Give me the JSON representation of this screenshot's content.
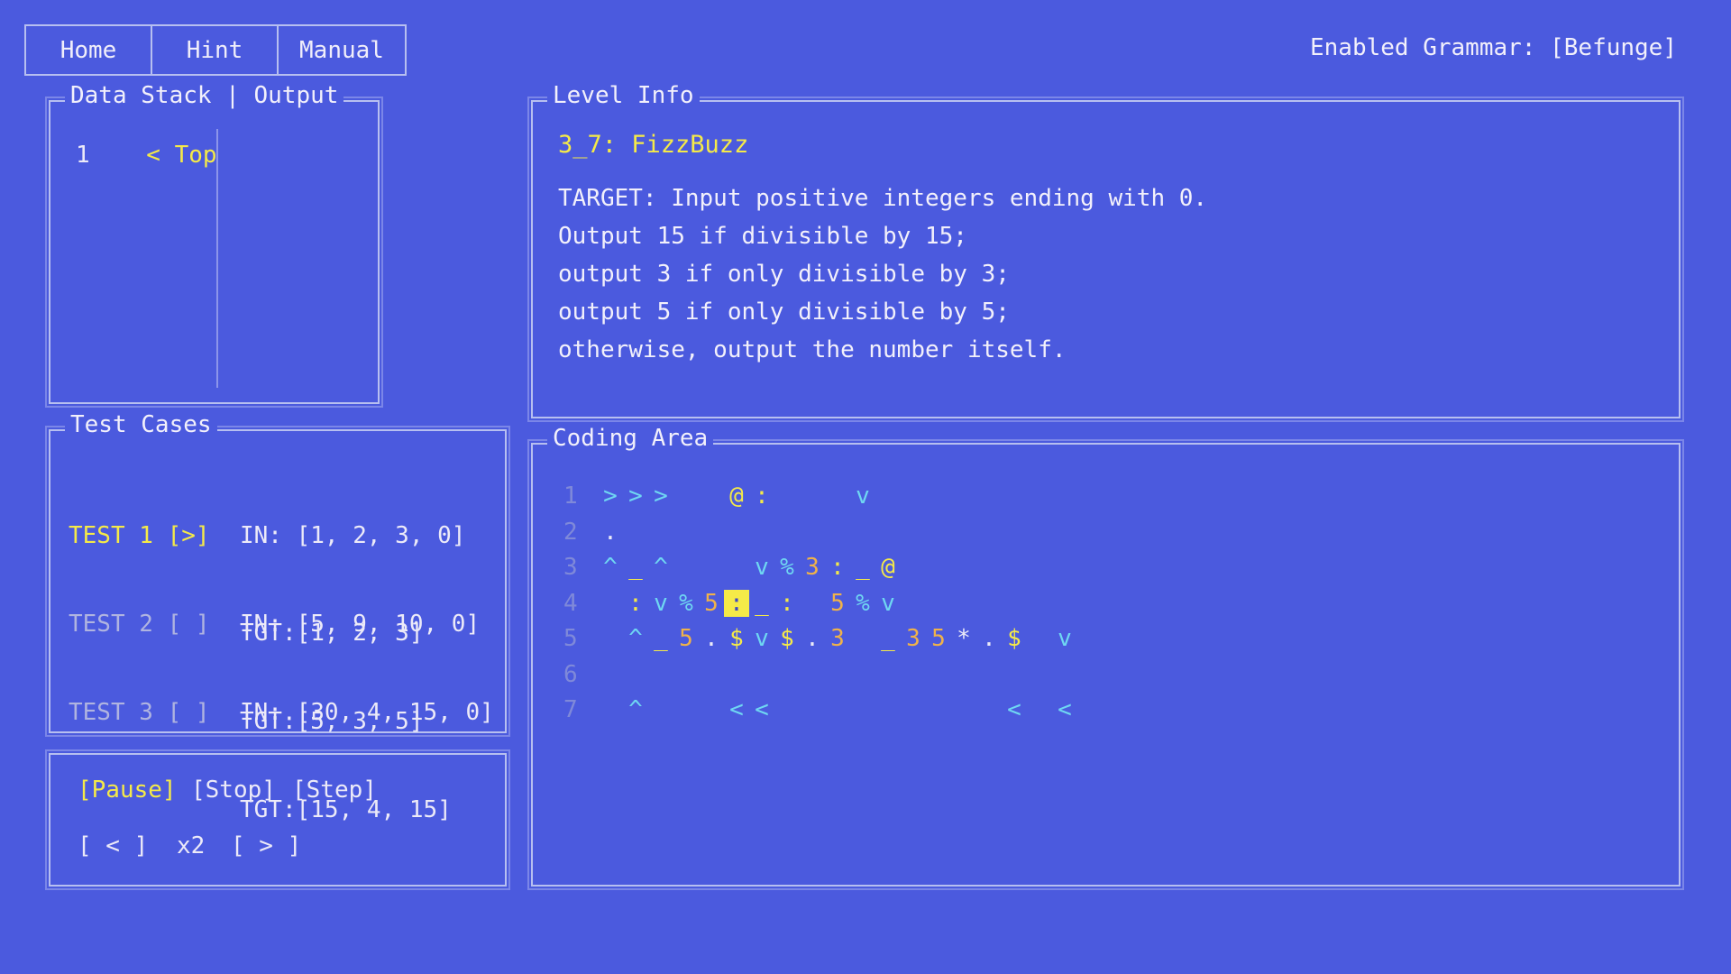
{
  "nav": {
    "home": "Home",
    "hint": "Hint",
    "manual": "Manual"
  },
  "grammar": "Enabled Grammar: [Befunge]",
  "stack_panel": {
    "title": "Data Stack | Output",
    "row_index": "1",
    "row_label": "< Top"
  },
  "tests_panel": {
    "title": "Test Cases",
    "tests": [
      {
        "label": "TEST 1 [>]",
        "in": "IN: [1, 2, 3, 0]",
        "tgt": "TGT:[1, 2, 3]"
      },
      {
        "label": "TEST 2 [ ]",
        "in": "IN: [5, 9, 10, 0]",
        "tgt": "TGT:[5, 3, 5]"
      },
      {
        "label": "TEST 3 [ ]",
        "in": "IN: [30, 4, 15, 0]",
        "tgt": "TGT:[15, 4, 15]"
      }
    ]
  },
  "controls": {
    "pause": "[Pause]",
    "stop": "[Stop]",
    "step": "[Step]",
    "slower": "[ < ]",
    "speed": "x2",
    "faster": "[ > ]"
  },
  "level": {
    "title": "Level Info",
    "name": "3_7: FizzBuzz",
    "desc": [
      "TARGET: Input positive integers ending with 0.",
      "Output 15 if divisible by 15;",
      "output 3 if only divisible by 3;",
      "output 5 if only divisible by 5;",
      "otherwise, output the number itself."
    ]
  },
  "code": {
    "title": "Coding Area",
    "lines": [
      {
        "num": "1",
        "cells": [
          {
            "col": 1,
            "ch": ">",
            "color": "cyan"
          },
          {
            "col": 2,
            "ch": ">",
            "color": "cyan"
          },
          {
            "col": 3,
            "ch": ">",
            "color": "cyan"
          },
          {
            "col": 6,
            "ch": "@",
            "color": "yellow"
          },
          {
            "col": 7,
            "ch": ":",
            "color": "yellow"
          },
          {
            "col": 11,
            "ch": "v",
            "color": "cyan"
          }
        ]
      },
      {
        "num": "2",
        "cells": [
          {
            "col": 1,
            "ch": ".",
            "color": "white"
          }
        ]
      },
      {
        "num": "3",
        "cells": [
          {
            "col": 1,
            "ch": "^",
            "color": "cyan"
          },
          {
            "col": 2,
            "ch": "_",
            "color": "yellow"
          },
          {
            "col": 3,
            "ch": "^",
            "color": "cyan"
          },
          {
            "col": 7,
            "ch": "v",
            "color": "cyan"
          },
          {
            "col": 8,
            "ch": "%",
            "color": "cyan"
          },
          {
            "col": 9,
            "ch": "3",
            "color": "orange"
          },
          {
            "col": 10,
            "ch": ":",
            "color": "yellow"
          },
          {
            "col": 11,
            "ch": "_",
            "color": "yellow"
          },
          {
            "col": 12,
            "ch": "@",
            "color": "yellow"
          }
        ]
      },
      {
        "num": "4",
        "cells": [
          {
            "col": 2,
            "ch": ":",
            "color": "yellow"
          },
          {
            "col": 3,
            "ch": "v",
            "color": "cyan"
          },
          {
            "col": 4,
            "ch": "%",
            "color": "cyan"
          },
          {
            "col": 5,
            "ch": "5",
            "color": "orange"
          },
          {
            "col": 6,
            "ch": ":",
            "color": "cursor"
          },
          {
            "col": 7,
            "ch": "_",
            "color": "yellow"
          },
          {
            "col": 8,
            "ch": ":",
            "color": "yellow"
          },
          {
            "col": 10,
            "ch": "5",
            "color": "orange"
          },
          {
            "col": 11,
            "ch": "%",
            "color": "cyan"
          },
          {
            "col": 12,
            "ch": "v",
            "color": "cyan"
          }
        ]
      },
      {
        "num": "5",
        "cells": [
          {
            "col": 2,
            "ch": "^",
            "color": "cyan"
          },
          {
            "col": 3,
            "ch": "_",
            "color": "yellow"
          },
          {
            "col": 4,
            "ch": "5",
            "color": "orange"
          },
          {
            "col": 5,
            "ch": ".",
            "color": "white"
          },
          {
            "col": 6,
            "ch": "$",
            "color": "yellow"
          },
          {
            "col": 7,
            "ch": "v",
            "color": "cyan"
          },
          {
            "col": 8,
            "ch": "$",
            "color": "yellow"
          },
          {
            "col": 9,
            "ch": ".",
            "color": "white"
          },
          {
            "col": 10,
            "ch": "3",
            "color": "orange"
          },
          {
            "col": 12,
            "ch": "_",
            "color": "yellow"
          },
          {
            "col": 13,
            "ch": "3",
            "color": "orange"
          },
          {
            "col": 14,
            "ch": "5",
            "color": "orange"
          },
          {
            "col": 15,
            "ch": "*",
            "color": "white"
          },
          {
            "col": 16,
            "ch": ".",
            "color": "white"
          },
          {
            "col": 17,
            "ch": "$",
            "color": "yellow"
          },
          {
            "col": 19,
            "ch": "v",
            "color": "cyan"
          }
        ]
      },
      {
        "num": "6",
        "cells": []
      },
      {
        "num": "7",
        "cells": [
          {
            "col": 2,
            "ch": "^",
            "color": "cyan"
          },
          {
            "col": 6,
            "ch": "<",
            "color": "cyan"
          },
          {
            "col": 7,
            "ch": "<",
            "color": "cyan"
          },
          {
            "col": 17,
            "ch": "<",
            "color": "cyan"
          },
          {
            "col": 19,
            "ch": "<",
            "color": "cyan"
          }
        ]
      }
    ]
  }
}
